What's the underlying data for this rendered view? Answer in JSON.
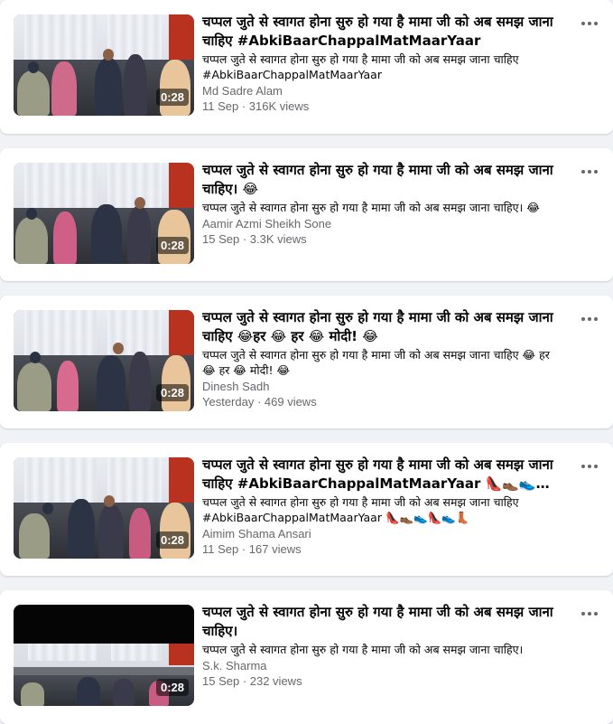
{
  "results": [
    {
      "title": "चप्पल जुते से स्वागत होना सुरु हो गया है मामा जी को अब समझ जाना चाहिए #AbkiBaarChappalMatMaarYaar",
      "description": "चप्पल जुते से स्वागत होना सुरु हो गया है मामा जी को अब समझ जाना चाहिए #AbkiBaarChappalMatMaarYaar",
      "author": "Md Sadre Alam",
      "date": "11 Sep",
      "views": "316K views",
      "meta": "11 Sep · 316K views",
      "duration": "0:28"
    },
    {
      "title": "चप्पल जुते से स्वागत होना सुरु हो गया है मामा जी को अब समझ जाना चाहिए। 😂",
      "description": "चप्पल जुते से स्वागत होना सुरु हो गया है मामा जी को अब समझ जाना चाहिए। 😂",
      "author": "Aamir Azmi Sheikh Sone",
      "date": "15 Sep",
      "views": "3.3K views",
      "meta": "15 Sep · 3.3K views",
      "duration": "0:28"
    },
    {
      "title": "चप्पल जुते से स्वागत होना सुरु हो गया है मामा जी को अब समझ जाना चाहिए 😂हर 😂 हर 😂 मोदी! 😂",
      "description": "चप्पल जुते से स्वागत होना सुरु हो गया है मामा जी को अब समझ जाना चाहिए 😂 हर 😂 हर 😂 मोदी! 😂",
      "author": "Dinesh Sadh",
      "date": "Yesterday",
      "views": "469 views",
      "meta": "Yesterday · 469 views",
      "duration": "0:28"
    },
    {
      "title": "चप्पल जुते से स्वागत होना सुरु हो गया है मामा जी को अब समझ जाना चाहिए #AbkiBaarChappalMatMaarYaar 👠👞👟👠...",
      "description": "चप्पल जुते से स्वागत होना सुरु हो गया है मामा जी को अब समझ जाना चाहिए #AbkiBaarChappalMatMaarYaar 👠👞👟👠👟👢",
      "author": "Aimim Shama Ansari",
      "date": "11 Sep",
      "views": "167 views",
      "meta": "11 Sep · 167 views",
      "duration": "0:28"
    },
    {
      "title": "चप्पल जुते से स्वागत होना सुरु हो गया है मामा जी को अब समझ जाना चाहिए।",
      "description": "चप्पल जुते से स्वागत होना सुरु हो गया है मामा जी को अब समझ जाना चाहिए।",
      "author": "S.k. Sharma",
      "date": "15 Sep",
      "views": "232 views",
      "meta": "15 Sep · 232 views",
      "duration": "0:28"
    }
  ],
  "icons": {
    "more": "more-options-icon"
  },
  "colors": {
    "page_background": "#f0f2f5",
    "card_background": "#ffffff",
    "secondary_text": "#65676b",
    "primary_text": "#050505"
  }
}
